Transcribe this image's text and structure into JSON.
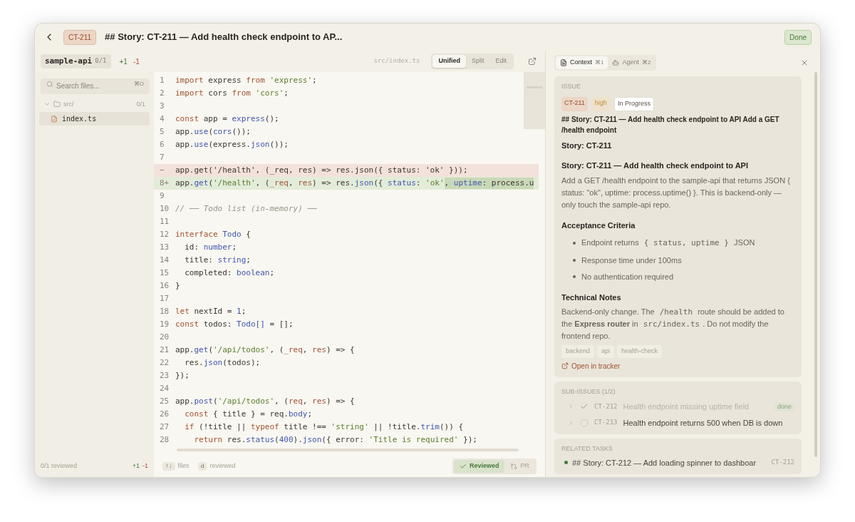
{
  "header": {
    "issue_id": "CT-211",
    "title": "## Story: CT-211 — Add health check endpoint to AP...",
    "status": "Done"
  },
  "toolbar": {
    "repo": "sample-api",
    "repo_count": "0/1",
    "added": "+1",
    "removed": "-1",
    "path": "src/index.ts",
    "views": [
      {
        "label": "Unified",
        "selected": true
      },
      {
        "label": "Split",
        "selected": false
      },
      {
        "label": "Edit",
        "selected": false
      }
    ]
  },
  "sidebar": {
    "search_placeholder": "Search files...",
    "search_shortcut": "⌘O",
    "tree": [
      {
        "name": "src/",
        "count": "0/1",
        "expanded": true,
        "children": [
          {
            "name": "index.ts",
            "selected": true
          }
        ]
      }
    ],
    "footer": {
      "reviewed": "0/1 reviewed",
      "added": "+1",
      "removed": "-1"
    }
  },
  "code": {
    "lines": [
      {
        "number": "1",
        "kind": "context",
        "tokens": [
          {
            "text": "import",
            "kind": "keyword"
          },
          {
            "text": " express ",
            "kind": "plain"
          },
          {
            "text": "from",
            "kind": "keyword"
          },
          {
            "text": " 'express'",
            "kind": "string"
          },
          {
            "text": ";",
            "kind": "plain"
          }
        ]
      },
      {
        "number": "2",
        "kind": "context",
        "tokens": [
          {
            "text": "import",
            "kind": "keyword"
          },
          {
            "text": " cors ",
            "kind": "plain"
          },
          {
            "text": "from",
            "kind": "keyword"
          },
          {
            "text": " 'cors'",
            "kind": "string"
          },
          {
            "text": ";",
            "kind": "plain"
          }
        ]
      },
      {
        "number": "3",
        "kind": "context"
      },
      {
        "number": "4",
        "kind": "context",
        "tokens": [
          {
            "text": "const",
            "kind": "keyword"
          },
          {
            "text": " app = ",
            "kind": "plain"
          },
          {
            "text": "express",
            "kind": "name"
          },
          {
            "text": "();",
            "kind": "plain"
          }
        ]
      },
      {
        "number": "5",
        "kind": "context",
        "tokens": [
          {
            "text": "app.",
            "kind": "plain"
          },
          {
            "text": "use",
            "kind": "name"
          },
          {
            "text": "(",
            "kind": "plain"
          },
          {
            "text": "cors",
            "kind": "name"
          },
          {
            "text": "());",
            "kind": "plain"
          }
        ]
      },
      {
        "number": "6",
        "kind": "context",
        "tokens": [
          {
            "text": "app.",
            "kind": "plain"
          },
          {
            "text": "use",
            "kind": "name"
          },
          {
            "text": "(express.",
            "kind": "plain"
          },
          {
            "text": "json",
            "kind": "name"
          },
          {
            "text": "());",
            "kind": "plain"
          }
        ]
      },
      {
        "number": "7",
        "kind": "context"
      },
      {
        "number": "−",
        "kind": "removed",
        "tokens": [
          {
            "text": "app.get('/health', (_req, res) => res.json({ status: 'ok' }));",
            "kind": "plain"
          }
        ]
      },
      {
        "number": "8+",
        "kind": "added",
        "segments": [
          {
            "changed": false,
            "tokens": [
              {
                "text": "app.",
                "kind": "plain"
              },
              {
                "text": "get",
                "kind": "name"
              },
              {
                "text": "(",
                "kind": "plain"
              },
              {
                "text": "'/health'",
                "kind": "string"
              },
              {
                "text": ", (",
                "kind": "plain"
              },
              {
                "text": "_req",
                "kind": "param"
              },
              {
                "text": ", ",
                "kind": "plain"
              },
              {
                "text": "res",
                "kind": "param"
              },
              {
                "text": ") => res.",
                "kind": "plain"
              },
              {
                "text": "json",
                "kind": "name"
              },
              {
                "text": "({ ",
                "kind": "plain"
              },
              {
                "text": "status",
                "kind": "name"
              },
              {
                "text": ": ",
                "kind": "plain"
              },
              {
                "text": "'ok'",
                "kind": "string"
              }
            ]
          },
          {
            "changed": true,
            "tokens": [
              {
                "text": ", ",
                "kind": "plain"
              },
              {
                "text": "uptime",
                "kind": "name"
              },
              {
                "text": ": process.u",
                "kind": "plain"
              }
            ]
          }
        ]
      },
      {
        "number": "9",
        "kind": "context"
      },
      {
        "number": "10",
        "kind": "context",
        "tokens": [
          {
            "text": "// ── Todo list (in-memory) ──",
            "kind": "comment"
          }
        ]
      },
      {
        "number": "11",
        "kind": "context"
      },
      {
        "number": "12",
        "kind": "context",
        "tokens": [
          {
            "text": "interface",
            "kind": "keyword"
          },
          {
            "text": " Todo",
            "kind": "name"
          },
          {
            "text": " {",
            "kind": "plain"
          }
        ]
      },
      {
        "number": "13",
        "kind": "context",
        "tokens": [
          {
            "text": "  id: ",
            "kind": "plain"
          },
          {
            "text": "number",
            "kind": "name"
          },
          {
            "text": ";",
            "kind": "plain"
          }
        ]
      },
      {
        "number": "14",
        "kind": "context",
        "tokens": [
          {
            "text": "  title: ",
            "kind": "plain"
          },
          {
            "text": "string",
            "kind": "name"
          },
          {
            "text": ";",
            "kind": "plain"
          }
        ]
      },
      {
        "number": "15",
        "kind": "context",
        "tokens": [
          {
            "text": "  completed: ",
            "kind": "plain"
          },
          {
            "text": "boolean",
            "kind": "name"
          },
          {
            "text": ";",
            "kind": "plain"
          }
        ]
      },
      {
        "number": "16",
        "kind": "context",
        "tokens": [
          {
            "text": "}",
            "kind": "plain"
          }
        ]
      },
      {
        "number": "17",
        "kind": "context"
      },
      {
        "number": "18",
        "kind": "context",
        "tokens": [
          {
            "text": "let",
            "kind": "keyword"
          },
          {
            "text": " nextId = ",
            "kind": "plain"
          },
          {
            "text": "1",
            "kind": "name"
          },
          {
            "text": ";",
            "kind": "plain"
          }
        ]
      },
      {
        "number": "19",
        "kind": "context",
        "tokens": [
          {
            "text": "const",
            "kind": "keyword"
          },
          {
            "text": " todos: ",
            "kind": "plain"
          },
          {
            "text": "Todo[]",
            "kind": "name"
          },
          {
            "text": " = [];",
            "kind": "plain"
          }
        ]
      },
      {
        "number": "20",
        "kind": "context"
      },
      {
        "number": "21",
        "kind": "context",
        "tokens": [
          {
            "text": "app.",
            "kind": "plain"
          },
          {
            "text": "get",
            "kind": "name"
          },
          {
            "text": "(",
            "kind": "plain"
          },
          {
            "text": "'/api/todos'",
            "kind": "string"
          },
          {
            "text": ", (",
            "kind": "plain"
          },
          {
            "text": "_req",
            "kind": "param"
          },
          {
            "text": ", ",
            "kind": "plain"
          },
          {
            "text": "res",
            "kind": "param"
          },
          {
            "text": ") => {",
            "kind": "plain"
          }
        ]
      },
      {
        "number": "22",
        "kind": "context",
        "tokens": [
          {
            "text": "  res.",
            "kind": "plain"
          },
          {
            "text": "json",
            "kind": "name"
          },
          {
            "text": "(todos);",
            "kind": "plain"
          }
        ]
      },
      {
        "number": "23",
        "kind": "context",
        "tokens": [
          {
            "text": "});",
            "kind": "plain"
          }
        ]
      },
      {
        "number": "24",
        "kind": "context"
      },
      {
        "number": "25",
        "kind": "context",
        "tokens": [
          {
            "text": "app.",
            "kind": "plain"
          },
          {
            "text": "post",
            "kind": "name"
          },
          {
            "text": "(",
            "kind": "plain"
          },
          {
            "text": "'/api/todos'",
            "kind": "string"
          },
          {
            "text": ", (",
            "kind": "plain"
          },
          {
            "text": "req",
            "kind": "param"
          },
          {
            "text": ", ",
            "kind": "plain"
          },
          {
            "text": "res",
            "kind": "param"
          },
          {
            "text": ") => {",
            "kind": "plain"
          }
        ]
      },
      {
        "number": "26",
        "kind": "context",
        "tokens": [
          {
            "text": "  const",
            "kind": "keyword"
          },
          {
            "text": " { title } = req.",
            "kind": "plain"
          },
          {
            "text": "body",
            "kind": "name"
          },
          {
            "text": ";",
            "kind": "plain"
          }
        ]
      },
      {
        "number": "27",
        "kind": "context",
        "tokens": [
          {
            "text": "  if",
            "kind": "keyword"
          },
          {
            "text": " (!title || ",
            "kind": "plain"
          },
          {
            "text": "typeof",
            "kind": "keyword"
          },
          {
            "text": " title !== ",
            "kind": "plain"
          },
          {
            "text": "'string'",
            "kind": "string"
          },
          {
            "text": " || !title.",
            "kind": "plain"
          },
          {
            "text": "trim",
            "kind": "name"
          },
          {
            "text": "()) {",
            "kind": "plain"
          }
        ]
      },
      {
        "number": "28",
        "kind": "context",
        "tokens": [
          {
            "text": "    return",
            "kind": "keyword"
          },
          {
            "text": " res.",
            "kind": "plain"
          },
          {
            "text": "status",
            "kind": "name"
          },
          {
            "text": "(",
            "kind": "plain"
          },
          {
            "text": "400",
            "kind": "name"
          },
          {
            "text": ").",
            "kind": "plain"
          },
          {
            "text": "json",
            "kind": "name"
          },
          {
            "text": "({ error: ",
            "kind": "plain"
          },
          {
            "text": "'Title is required'",
            "kind": "string"
          },
          {
            "text": " });",
            "kind": "plain"
          }
        ]
      }
    ],
    "footer": {
      "hints": [
        {
          "key": "↑↓",
          "label": "files"
        },
        {
          "key": "d",
          "label": "reviewed"
        }
      ],
      "actions": [
        {
          "label": "Reviewed",
          "kind": "reviewed",
          "selected": true
        },
        {
          "label": "PR",
          "kind": "pr",
          "selected": false
        }
      ]
    }
  },
  "panel": {
    "tabs": [
      {
        "label": "Context",
        "shortcut": "⌘1",
        "kind": "doc",
        "selected": true
      },
      {
        "label": "Agent",
        "shortcut": "⌘2",
        "kind": "bot",
        "selected": false
      }
    ],
    "issue": {
      "heading": "ISSUE",
      "badges": [
        {
          "text": "CT-211",
          "kind": "id"
        },
        {
          "text": "high",
          "kind": "priority"
        },
        {
          "text": "In Progress",
          "kind": "status"
        }
      ],
      "summary": "## Story: CT-211 — Add health check endpoint to API Add a GET /health endpoint",
      "story": "Story: CT-211",
      "title": "Story: CT-211 — Add health check endpoint to API",
      "description": "Add a GET /health endpoint to the sample-api that returns JSON { status: \"ok\", uptime: process.uptime() }. This is backend-only — only touch the sample-api repo.",
      "criteria_heading": "Acceptance Criteria",
      "criteria": [
        [
          {
            "text": "Endpoint returns ",
            "kind": "text"
          },
          {
            "text": "{ status, uptime }",
            "kind": "code"
          },
          {
            "text": " JSON",
            "kind": "text"
          }
        ],
        [
          {
            "text": "Response time under 100ms",
            "kind": "text"
          }
        ],
        [
          {
            "text": "No authentication required",
            "kind": "text"
          }
        ]
      ],
      "notes_heading": "Technical Notes",
      "notes": [
        {
          "text": "Backend-only change. The ",
          "kind": "text"
        },
        {
          "text": "/health",
          "kind": "code"
        },
        {
          "text": " route should be added to the **Express router** in ",
          "kind": "text"
        },
        {
          "text": "src/index.ts",
          "kind": "code"
        },
        {
          "text": ". Do not modify the frontend repo.",
          "kind": "text"
        }
      ],
      "tags": [
        "backend",
        "api",
        "health-check"
      ],
      "link": "Open in tracker"
    },
    "sub_issues": {
      "heading": "SUB-ISSUES (1/2)",
      "items": [
        {
          "id": "CT-212",
          "title": "Health endpoint missing uptime field",
          "done": true,
          "badge": "done"
        },
        {
          "id": "CT-213",
          "title": "Health endpoint returns 500 when DB is down",
          "done": false
        }
      ]
    },
    "related": {
      "heading": "RELATED TASKS",
      "items": [
        {
          "title": "## Story: CT-212 — Add loading spinner to dashboar",
          "id": "CT-212",
          "color": "#4a7a3e"
        }
      ]
    }
  }
}
